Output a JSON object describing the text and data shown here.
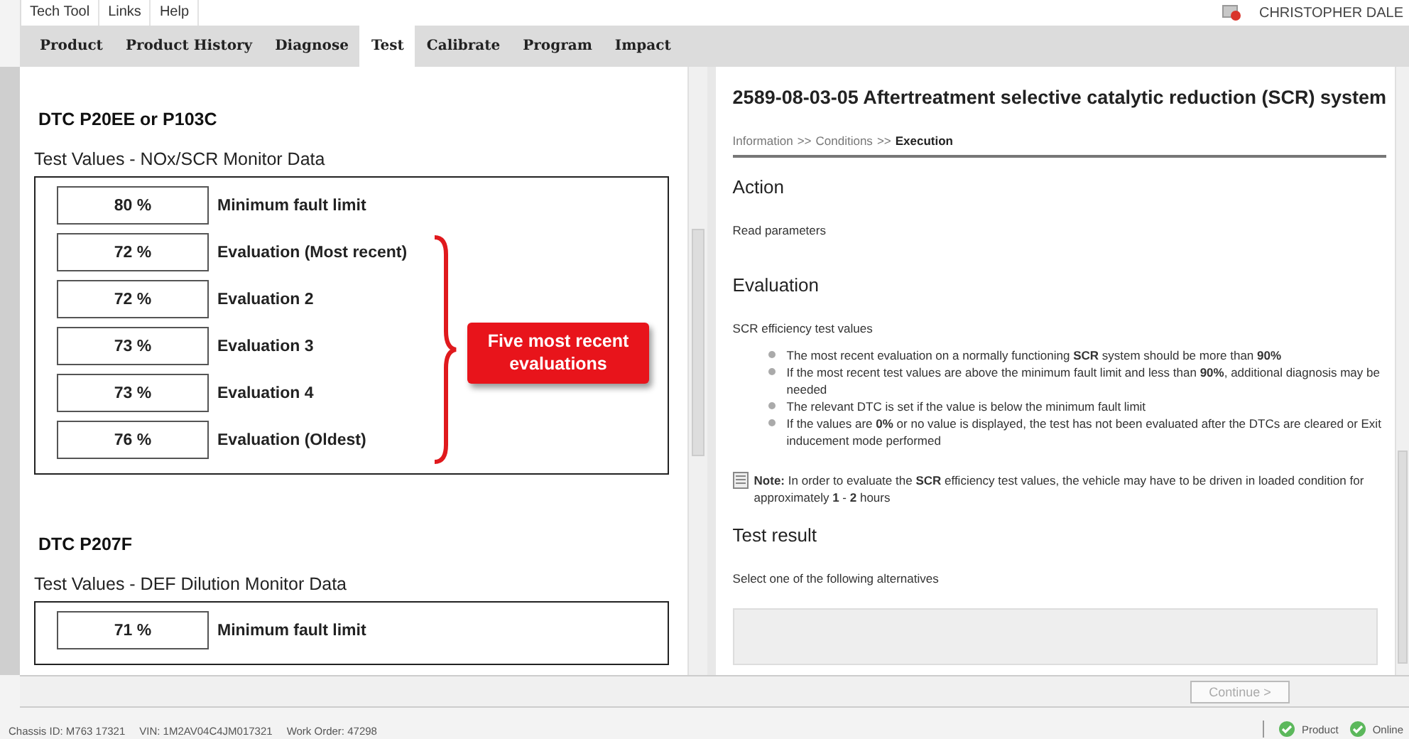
{
  "menu": [
    "Tech Tool",
    "Links",
    "Help"
  ],
  "user": "CHRISTOPHER DALE",
  "tabs": [
    {
      "label": "Product",
      "selected": false
    },
    {
      "label": "Product History",
      "selected": false
    },
    {
      "label": "Diagnose",
      "selected": false
    },
    {
      "label": "Test",
      "selected": true
    },
    {
      "label": "Calibrate",
      "selected": false
    },
    {
      "label": "Program",
      "selected": false
    },
    {
      "label": "Impact",
      "selected": false
    }
  ],
  "left": {
    "sections": [
      {
        "dtc": "DTC P20EE or P103C",
        "subtitle": "Test Values - NOx/SCR Monitor Data",
        "rows": [
          {
            "value": "80 %",
            "label": "Minimum fault limit"
          },
          {
            "value": "72 %",
            "label": "Evaluation (Most recent)"
          },
          {
            "value": "72 %",
            "label": "Evaluation 2"
          },
          {
            "value": "73 %",
            "label": "Evaluation 3"
          },
          {
            "value": "73 %",
            "label": "Evaluation 4"
          },
          {
            "value": "76 %",
            "label": "Evaluation (Oldest)"
          }
        ],
        "callout": "Five most recent evaluations"
      },
      {
        "dtc": "DTC P207F",
        "subtitle": "Test Values - DEF Dilution Monitor Data",
        "rows": [
          {
            "value": "71 %",
            "label": "Minimum fault limit"
          }
        ]
      }
    ]
  },
  "right": {
    "title": "2589-08-03-05 Aftertreatment selective catalytic reduction (SCR) system",
    "breadcrumb": [
      {
        "label": "Information",
        "current": false
      },
      {
        "label": ">>",
        "current": false
      },
      {
        "label": "Conditions",
        "current": false
      },
      {
        "label": ">>",
        "current": false
      },
      {
        "label": "Execution",
        "current": true
      }
    ],
    "blocks": [
      {
        "kind": "heading",
        "text": "Action"
      },
      {
        "kind": "paragraph",
        "text": "Read parameters"
      },
      {
        "kind": "heading",
        "text": "Evaluation"
      },
      {
        "kind": "paragraph",
        "text": "SCR efficiency test values"
      },
      {
        "kind": "bullets",
        "items": [
          "The most recent evaluation on a normally functioning **SCR** system should be more than **90%**",
          "If the most recent test values are above the minimum fault limit and less than **90%**, additional diagnosis may be needed",
          "The relevant DTC is set if the value is below the minimum fault limit",
          "If the values are **0%** or no value is displayed, the test has not been evaluated after the DTCs are cleared or Exit inducement mode performed"
        ]
      },
      {
        "kind": "note",
        "text": "**Note:** In order to evaluate the **SCR** efficiency test values, the vehicle may have to be driven in loaded condition for approximately **1** - **2** hours"
      },
      {
        "kind": "heading",
        "text": "Test result"
      },
      {
        "kind": "paragraph",
        "text": "Select one of the following alternatives"
      },
      {
        "kind": "options"
      }
    ]
  },
  "footer": {
    "button": {
      "label": "Continue >",
      "disabled": true
    }
  },
  "status": {
    "fields": [
      "Chassis ID: M763 17321",
      "VIN: 1M2AV04C4JM017321",
      "Work Order: 47298"
    ],
    "indicators": [
      {
        "label": "Product",
        "ok": true
      },
      {
        "label": "Online",
        "ok": true
      }
    ]
  }
}
